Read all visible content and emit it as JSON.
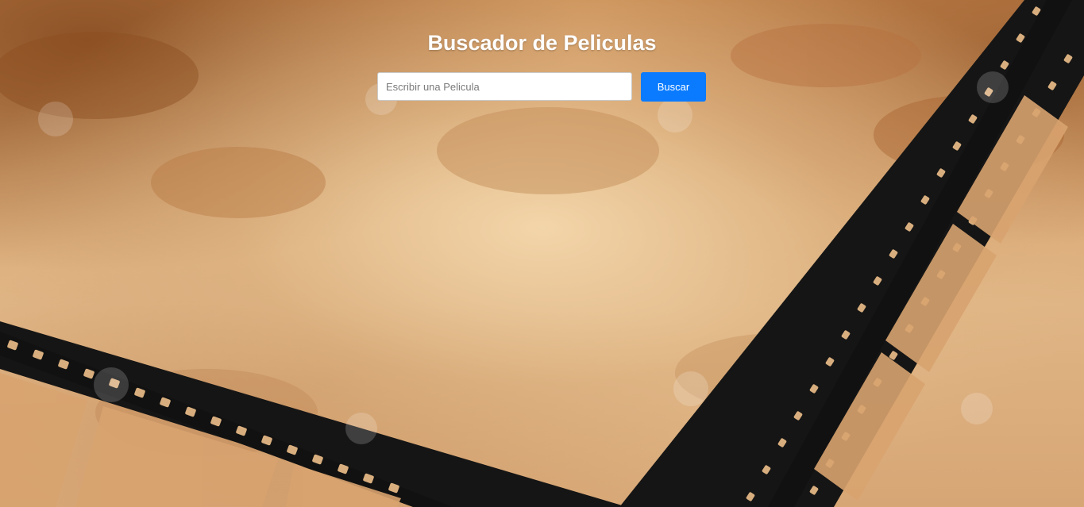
{
  "header": {
    "title": "Buscador de Peliculas"
  },
  "search": {
    "placeholder": "Escribir una Pelicula",
    "value": "",
    "button_label": "Buscar"
  },
  "background": {
    "description_icon": "film-strip-icon",
    "colors": {
      "paper": "#d9a874",
      "film": "#111111",
      "button": "#0a7bff"
    }
  }
}
